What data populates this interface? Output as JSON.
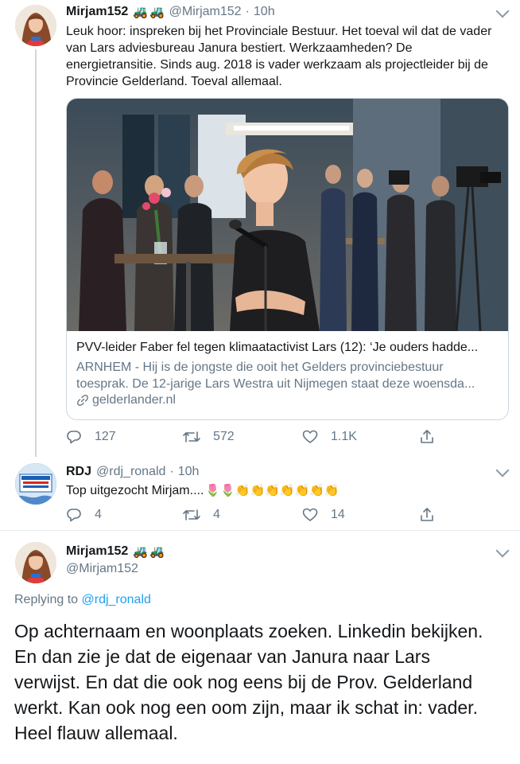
{
  "tweet1": {
    "name": "Mirjam152",
    "badges": [
      "tractor-emoji",
      "tractor-emoji"
    ],
    "badge_glyph": "🚜",
    "handle": "@Mirjam152",
    "separator": "·",
    "time": "10h",
    "text": "Leuk hoor: inspreken bij het Provinciale Bestuur. Het toeval wil dat de vader van Lars adviesbureau Janura bestiert. Werkzaamheden? De energietransitie. Sinds aug. 2018 is vader werkzaam als projectleider bij de Provincie Gelderland. Toeval allemaal.",
    "card": {
      "title": "PVV-leider Faber fel tegen klimaatactivist Lars (12): ‘Je ouders hadde...",
      "description": "ARNHEM - Hij is de jongste die ooit het Gelders provinciebestuur toesprak. De 12-jarige Lars Westra uit Nijmegen staat deze woensda...",
      "domain": "gelderlander.nl"
    },
    "actions": {
      "replies": "127",
      "retweets": "572",
      "likes": "1.1K"
    }
  },
  "tweet2": {
    "name": "RDJ",
    "handle": "@rdj_ronald",
    "separator": "·",
    "time": "10h",
    "text": "Top uitgezocht Mirjam....",
    "emojis": [
      "🌷",
      "🌷",
      "👏",
      "👏",
      "👏",
      "👏",
      "👏",
      "👏",
      "👏"
    ],
    "actions": {
      "replies": "4",
      "retweets": "4",
      "likes": "14"
    }
  },
  "tweet3": {
    "name": "Mirjam152",
    "badge_glyph": "🚜",
    "handle": "@Mirjam152",
    "replying_prefix": "Replying to ",
    "replying_to": "@rdj_ronald",
    "text": "Op achternaam en woonplaats zoeken. Linkedin bekijken. En dan zie je dat de eigenaar van Janura naar Lars verwijst. En dat die ook nog eens bij de Prov. Gelderland werkt. Kan ook nog een oom zijn, maar ik schat in: vader. Heel flauw allemaal."
  },
  "colors": {
    "text": "#14171a",
    "secondary": "#657786",
    "link": "#1da1f2",
    "border": "#ccd6dd"
  }
}
